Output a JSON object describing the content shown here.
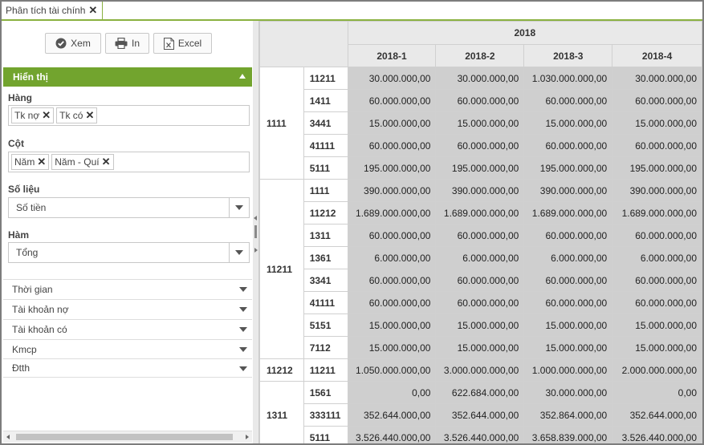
{
  "tab": {
    "title": "Phân tích tài chính",
    "close": "✕"
  },
  "toolbar": {
    "view_label": "Xem",
    "print_label": "In",
    "excel_label": "Excel"
  },
  "panel": {
    "header": "Hiển thị",
    "rows_label": "Hàng",
    "rows_chips": [
      "Tk nợ",
      "Tk có"
    ],
    "cols_label": "Cột",
    "cols_chips": [
      "Năm",
      "Năm - Quí"
    ],
    "values_label": "Số liệu",
    "values_selected": "Số tiền",
    "func_label": "Hàm",
    "func_selected": "Tổng",
    "chip_close": "✕"
  },
  "filters": [
    "Thời gian",
    "Tài khoản nợ",
    "Tài khoản có",
    "Kmcp",
    "Đtth"
  ],
  "pivot": {
    "year": "2018",
    "columns": [
      "2018-1",
      "2018-2",
      "2018-3",
      "2018-4"
    ],
    "groups": [
      {
        "account": "1111",
        "rows": [
          {
            "sub": "11211",
            "values": [
              "30.000.000,00",
              "30.000.000,00",
              "1.030.000.000,00",
              "30.000.000,00"
            ]
          },
          {
            "sub": "1411",
            "values": [
              "60.000.000,00",
              "60.000.000,00",
              "60.000.000,00",
              "60.000.000,00"
            ]
          },
          {
            "sub": "3441",
            "values": [
              "15.000.000,00",
              "15.000.000,00",
              "15.000.000,00",
              "15.000.000,00"
            ]
          },
          {
            "sub": "41111",
            "values": [
              "60.000.000,00",
              "60.000.000,00",
              "60.000.000,00",
              "60.000.000,00"
            ]
          },
          {
            "sub": "5111",
            "values": [
              "195.000.000,00",
              "195.000.000,00",
              "195.000.000,00",
              "195.000.000,00"
            ]
          }
        ]
      },
      {
        "account": "11211",
        "rows": [
          {
            "sub": "1111",
            "values": [
              "390.000.000,00",
              "390.000.000,00",
              "390.000.000,00",
              "390.000.000,00"
            ]
          },
          {
            "sub": "11212",
            "values": [
              "1.689.000.000,00",
              "1.689.000.000,00",
              "1.689.000.000,00",
              "1.689.000.000,00"
            ]
          },
          {
            "sub": "1311",
            "values": [
              "60.000.000,00",
              "60.000.000,00",
              "60.000.000,00",
              "60.000.000,00"
            ]
          },
          {
            "sub": "1361",
            "values": [
              "6.000.000,00",
              "6.000.000,00",
              "6.000.000,00",
              "6.000.000,00"
            ]
          },
          {
            "sub": "3341",
            "values": [
              "60.000.000,00",
              "60.000.000,00",
              "60.000.000,00",
              "60.000.000,00"
            ]
          },
          {
            "sub": "41111",
            "values": [
              "60.000.000,00",
              "60.000.000,00",
              "60.000.000,00",
              "60.000.000,00"
            ]
          },
          {
            "sub": "5151",
            "values": [
              "15.000.000,00",
              "15.000.000,00",
              "15.000.000,00",
              "15.000.000,00"
            ]
          },
          {
            "sub": "7112",
            "values": [
              "15.000.000,00",
              "15.000.000,00",
              "15.000.000,00",
              "15.000.000,00"
            ]
          }
        ]
      },
      {
        "account": "11212",
        "rows": [
          {
            "sub": "11211",
            "values": [
              "1.050.000.000,00",
              "3.000.000.000,00",
              "1.000.000.000,00",
              "2.000.000.000,00"
            ]
          }
        ]
      },
      {
        "account": "1311",
        "rows": [
          {
            "sub": "1561",
            "values": [
              "0,00",
              "622.684.000,00",
              "30.000.000,00",
              "0,00"
            ]
          },
          {
            "sub": "333111",
            "values": [
              "352.644.000,00",
              "352.644.000,00",
              "352.864.000,00",
              "352.644.000,00"
            ]
          },
          {
            "sub": "5111",
            "values": [
              "3.526.440.000,00",
              "3.526.440.000,00",
              "3.658.839.000,00",
              "3.526.440.000,00"
            ]
          }
        ]
      }
    ]
  },
  "colors": {
    "accent": "#72a42e",
    "tab_border": "#8ab140",
    "cell_bg": "#cfcfcf",
    "header_bg": "#e9e9e9"
  }
}
